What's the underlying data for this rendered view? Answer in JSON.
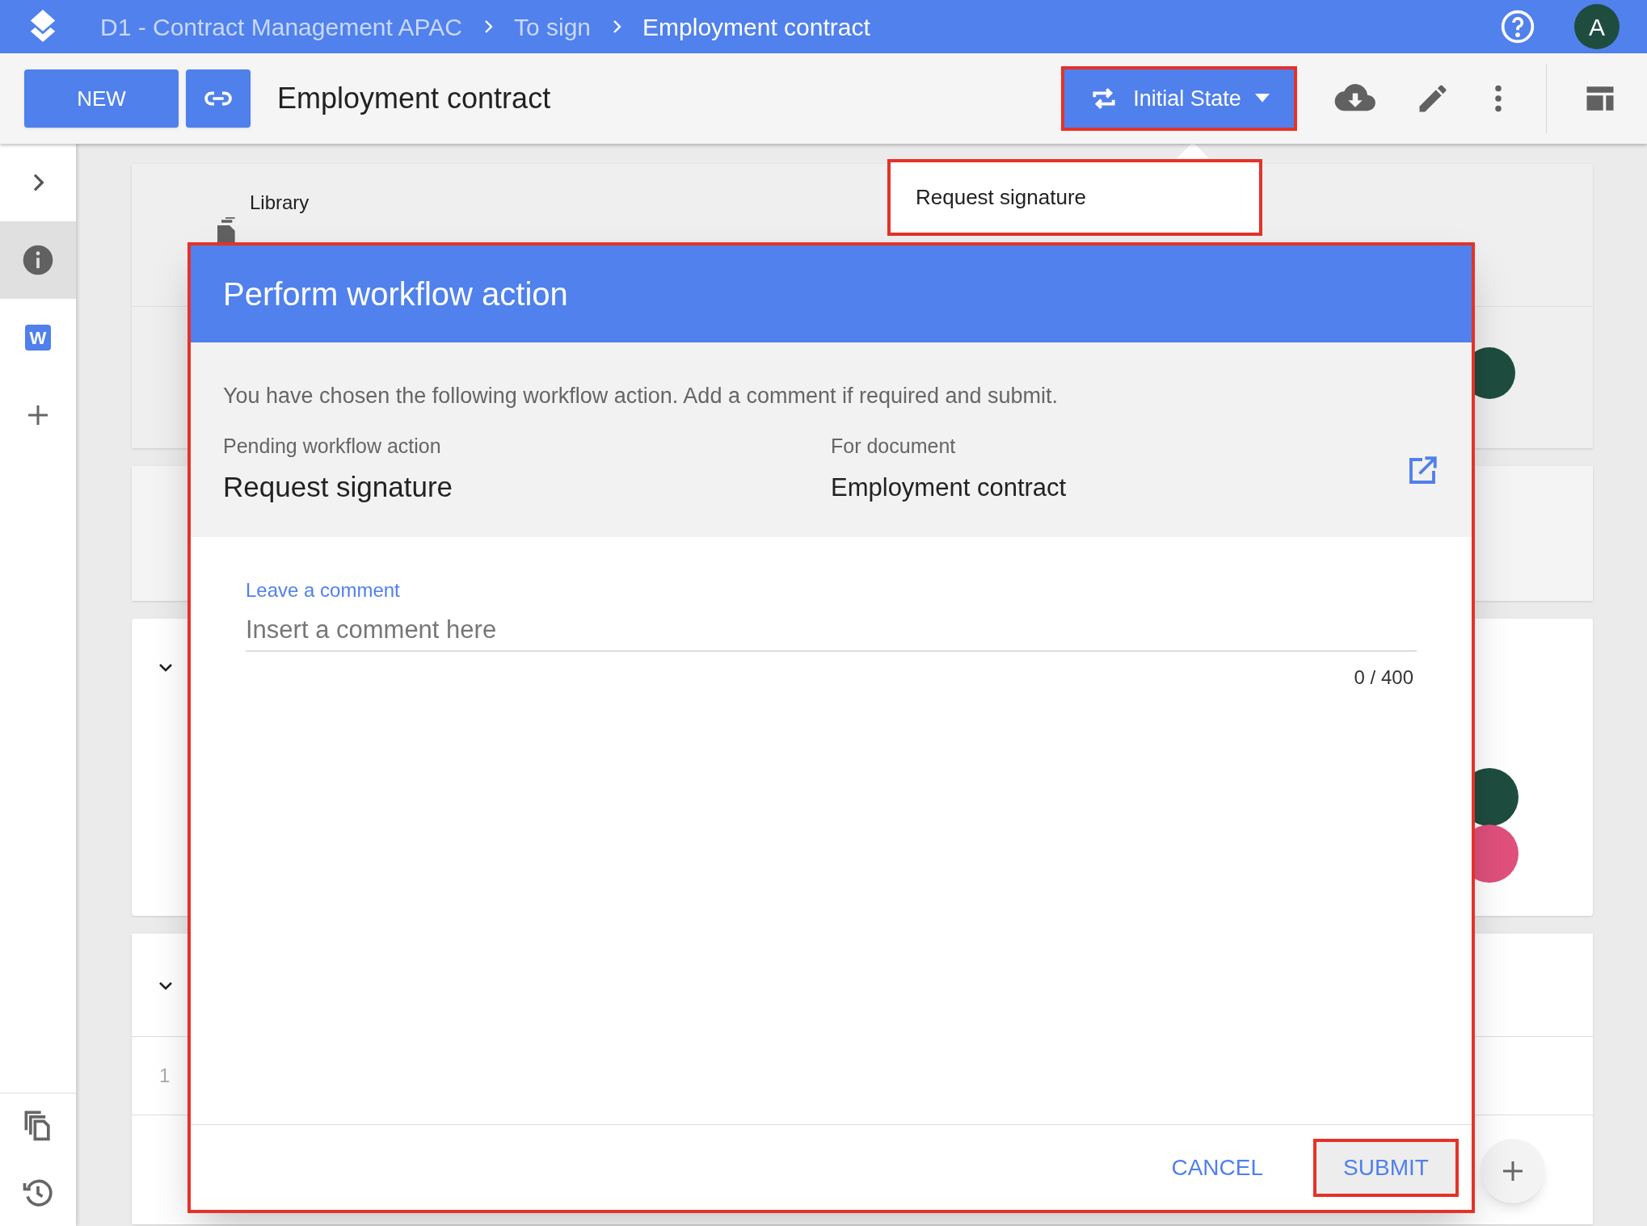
{
  "topbar": {
    "breadcrumbs": [
      {
        "label": "D1 - Contract Management APAC",
        "current": false
      },
      {
        "label": "To sign",
        "current": false
      },
      {
        "label": "Employment contract",
        "current": true
      }
    ],
    "avatar": "A"
  },
  "toolbar": {
    "new_button": "NEW",
    "title": "Employment contract",
    "state_button": "Initial State"
  },
  "sidebar": {
    "items": [
      {
        "kind": "expand",
        "selected": false
      },
      {
        "kind": "info",
        "selected": true
      },
      {
        "kind": "word",
        "selected": false,
        "label": "W"
      },
      {
        "kind": "add",
        "selected": false
      }
    ]
  },
  "background": {
    "library_label": "Library",
    "row_number": "1"
  },
  "menu": {
    "items": [
      {
        "label": "Request signature"
      }
    ]
  },
  "dialog": {
    "title": "Perform workflow action",
    "intro": "You have chosen the following workflow action. Add a comment if required and submit.",
    "pending_label": "Pending workflow action",
    "pending_value": "Request signature",
    "document_label": "For document",
    "document_value": "Employment contract",
    "comment": {
      "label": "Leave a comment",
      "placeholder": "Insert a comment here",
      "counter": "0 / 400"
    },
    "buttons": [
      {
        "kind": "text",
        "label": "CANCEL"
      },
      {
        "kind": "raised",
        "label": "SUBMIT"
      }
    ]
  }
}
